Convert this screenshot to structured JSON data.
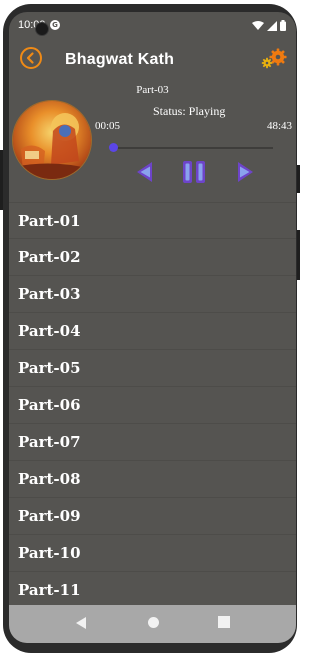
{
  "statusbar": {
    "time": "10:09",
    "notif_letter": "G"
  },
  "header": {
    "title": "Bhagwat Kath"
  },
  "player": {
    "track": "Part-03",
    "status": "Status: Playing",
    "current_time": "00:05",
    "total_time": "48:43",
    "progress": 0.002
  },
  "parts": [
    "Part-01",
    "Part-02",
    "Part-03",
    "Part-04",
    "Part-05",
    "Part-06",
    "Part-07",
    "Part-08",
    "Part-09",
    "Part-10",
    "Part-11"
  ],
  "colors": {
    "accent": "#ef8a16",
    "seek": "#5b46e8",
    "background": "#555451",
    "control": "#6d44c9"
  }
}
